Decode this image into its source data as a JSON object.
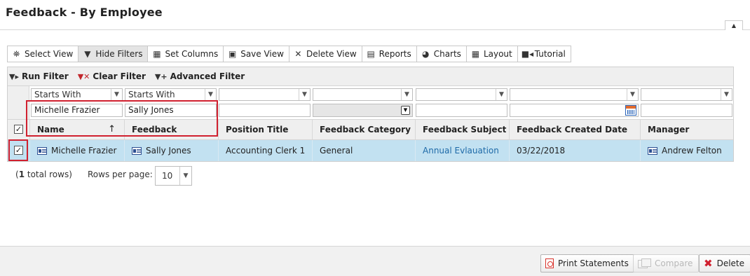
{
  "page": {
    "title": "Feedback - By Employee",
    "collapse_icon": "caret-up"
  },
  "toolbar": {
    "items": [
      {
        "label": "Select View",
        "icon": "binoculars"
      },
      {
        "label": "Hide Filters",
        "icon": "filter",
        "active": true
      },
      {
        "label": "Set Columns",
        "icon": "table-grid"
      },
      {
        "label": "Save View",
        "icon": "floppy-disk"
      },
      {
        "label": "Delete View",
        "icon": "close-x"
      },
      {
        "label": "Reports",
        "icon": "document"
      },
      {
        "label": "Charts",
        "icon": "pie-chart"
      },
      {
        "label": "Layout",
        "icon": "table-grid"
      },
      {
        "label": "Tutorial",
        "icon": "video-camera"
      }
    ]
  },
  "filter_bar": {
    "run": "Run Filter",
    "clear": "Clear Filter",
    "advanced": "Advanced Filter"
  },
  "filters": {
    "name": {
      "operator": "Starts With",
      "value": "Michelle Frazier"
    },
    "provider": {
      "operator": "Starts With",
      "value": "Sally Jones"
    },
    "position": {
      "operator": "",
      "value": ""
    },
    "category": {
      "operator": "",
      "value": ""
    },
    "subject": {
      "operator": "",
      "value": ""
    },
    "created": {
      "operator": "",
      "value": ""
    },
    "manager": {
      "operator": "",
      "value": ""
    }
  },
  "columns": {
    "name": "Name",
    "provider": "Feedback Provider",
    "position": "Position Title",
    "category": "Feedback Category",
    "subject": "Feedback Subject",
    "created": "Feedback Created Date",
    "manager": "Manager",
    "sort_indicator": "↑"
  },
  "row": {
    "checked": true,
    "name": "Michelle Frazier",
    "provider": "Sally Jones",
    "position": "Accounting Clerk 1",
    "category": "General",
    "subject": "Annual Evlauation",
    "created": "03/22/2018",
    "manager": "Andrew Felton"
  },
  "pager": {
    "total_count": "1",
    "total_suffix": " total rows)",
    "open_paren": "(",
    "rows_per_page_label": "Rows per page:",
    "rows_per_page": "10"
  },
  "footer": {
    "print": "Print Statements",
    "compare": "Compare",
    "delete": "Delete"
  },
  "colors": {
    "selected_row": "#c2e1f1",
    "highlight_box": "#d0202f",
    "link": "#1e6aa8"
  }
}
